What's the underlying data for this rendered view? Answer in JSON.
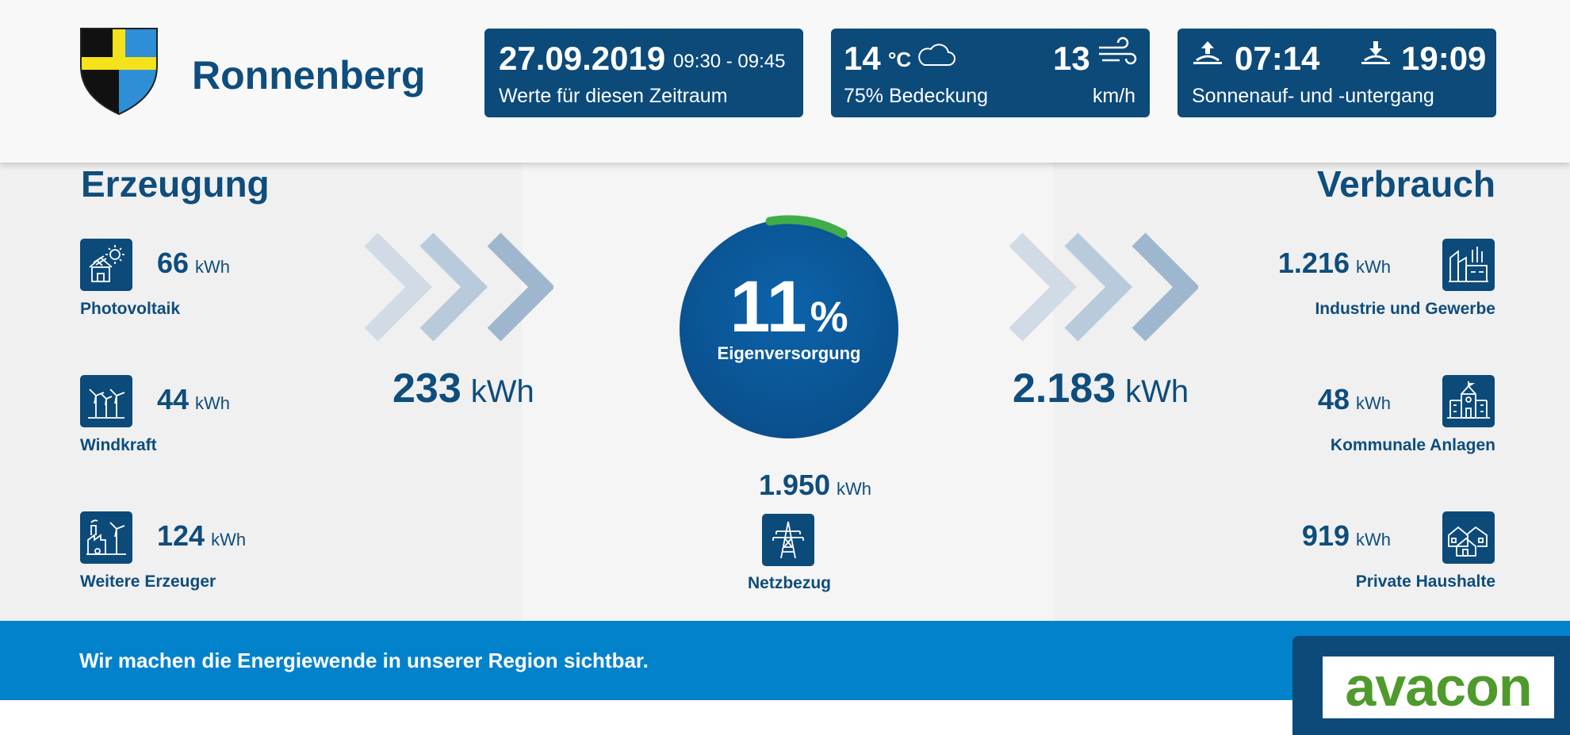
{
  "header": {
    "town": "Ronnenberg",
    "date_card": {
      "date": "27.09.2019",
      "time_range": "09:30 - 09:45",
      "caption": "Werte für diesen Zeitraum"
    },
    "weather_card": {
      "temperature": "14",
      "temperature_unit": "°C",
      "cloud_cover": "75% Bedeckung",
      "wind_speed": "13",
      "wind_unit": "km/h",
      "weather_icon": "cloud-icon",
      "wind_icon": "wind-icon"
    },
    "sun_card": {
      "sunrise": "07:14",
      "sunset": "19:09",
      "caption": "Sonnenauf- und -untergang",
      "sunrise_icon": "sunrise-icon",
      "sunset_icon": "sunset-icon"
    }
  },
  "generation": {
    "title": "Erzeugung",
    "items": [
      {
        "value": "66",
        "unit": "kWh",
        "label": "Photovoltaik",
        "icon": "solar-house-icon"
      },
      {
        "value": "44",
        "unit": "kWh",
        "label": "Windkraft",
        "icon": "wind-turbines-icon"
      },
      {
        "value": "124",
        "unit": "kWh",
        "label": "Weitere Erzeuger",
        "icon": "factory-turbine-icon"
      }
    ],
    "total": {
      "value": "233",
      "unit": "kWh"
    }
  },
  "center": {
    "self_supply_value": "11",
    "self_supply_unit": "%",
    "self_supply_fraction": 0.11,
    "self_supply_label": "Eigenversorgung",
    "grid": {
      "value": "1.950",
      "unit": "kWh",
      "label": "Netzbezug",
      "icon": "power-pylon-icon"
    }
  },
  "consumption": {
    "title": "Verbrauch",
    "items": [
      {
        "value": "1.216",
        "unit": "kWh",
        "label": "Industrie und Gewerbe",
        "icon": "industry-icon"
      },
      {
        "value": "48",
        "unit": "kWh",
        "label": "Kommunale Anlagen",
        "icon": "town-hall-icon"
      },
      {
        "value": "919",
        "unit": "kWh",
        "label": "Private Haushalte",
        "icon": "houses-icon"
      }
    ],
    "total": {
      "value": "2.183",
      "unit": "kWh"
    }
  },
  "footer": {
    "slogan": "Wir machen die Energiewende in unserer Region sichtbar.",
    "logo": "avacon"
  },
  "colors": {
    "navy": "#0c4a7a",
    "title_blue": "#0e4d7c",
    "footer_blue": "#0382cc",
    "progress_green": "#3fae49",
    "logo_green": "#4f9a2c"
  }
}
